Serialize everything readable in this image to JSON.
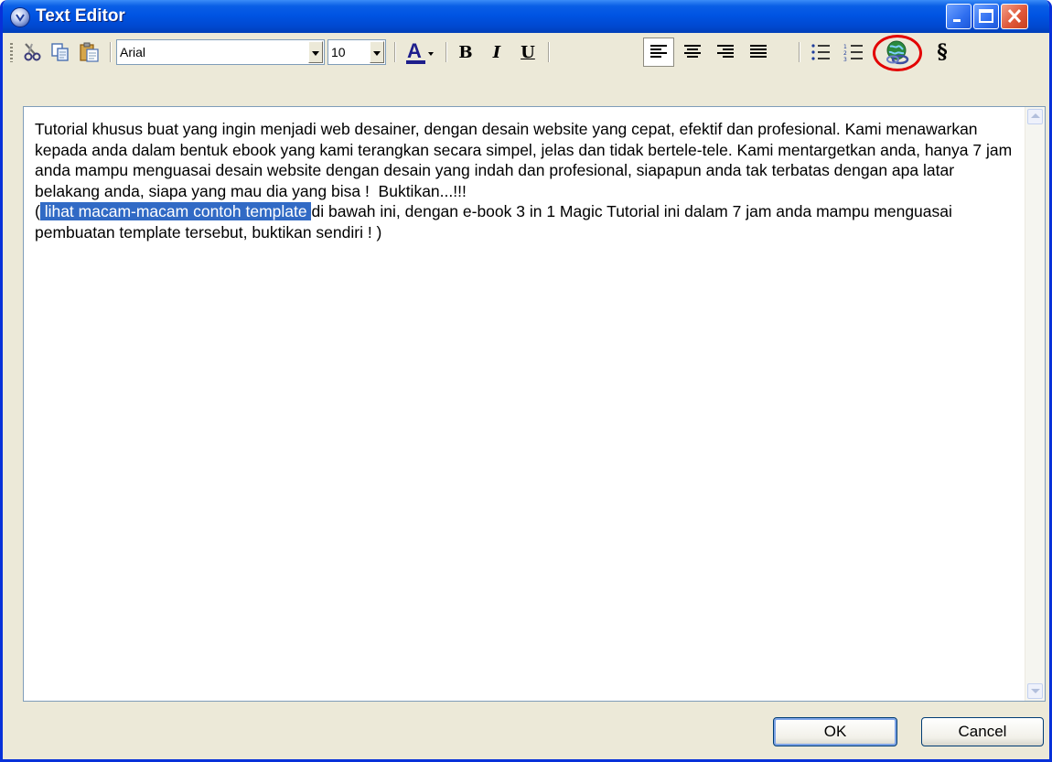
{
  "window": {
    "title": "Text Editor"
  },
  "toolbar": {
    "font_name": "Arial",
    "font_size": "10",
    "bold_label": "B",
    "italic_label": "I",
    "underline_label": "U",
    "section_label": "§",
    "font_color_label": "A",
    "tools": [
      "cut-icon",
      "copy-icon",
      "paste-icon",
      "font-color-icon",
      "bold-icon",
      "italic-icon",
      "underline-icon",
      "align-left-icon",
      "align-center-icon",
      "align-right-icon",
      "align-justify-icon",
      "bullet-list-icon",
      "numbered-list-icon",
      "insert-link-icon",
      "section-icon"
    ],
    "active_alignment": "left",
    "highlighted_tool": "insert-link-icon",
    "highlight_color": "#e30000"
  },
  "editor": {
    "paragraph1": "Tutorial khusus buat yang ingin menjadi web desainer, dengan desain website yang cepat, efektif dan profesional. Kami menawarkan kepada anda dalam bentuk ebook yang kami terangkan secara simpel, jelas dan tidak bertele-tele. Kami mentargetkan anda, hanya 7 jam anda mampu menguasai desain website dengan desain yang indah dan profesional, siapapun anda tak terbatas dengan apa latar belakang anda, siapa yang mau dia yang bisa !  Buktikan...!!!",
    "paragraph2_prefix": "(",
    "selected_text": " lihat macam-macam contoh template ",
    "paragraph2_rest": "di bawah ini, dengan e-book 3 in 1 Magic Tutorial ini dalam 7 jam anda mampu menguasai pembuatan template tersebut, buktikan sendiri ! )",
    "selection_color": "#316ac5"
  },
  "buttons": {
    "ok": "OK",
    "cancel": "Cancel"
  }
}
